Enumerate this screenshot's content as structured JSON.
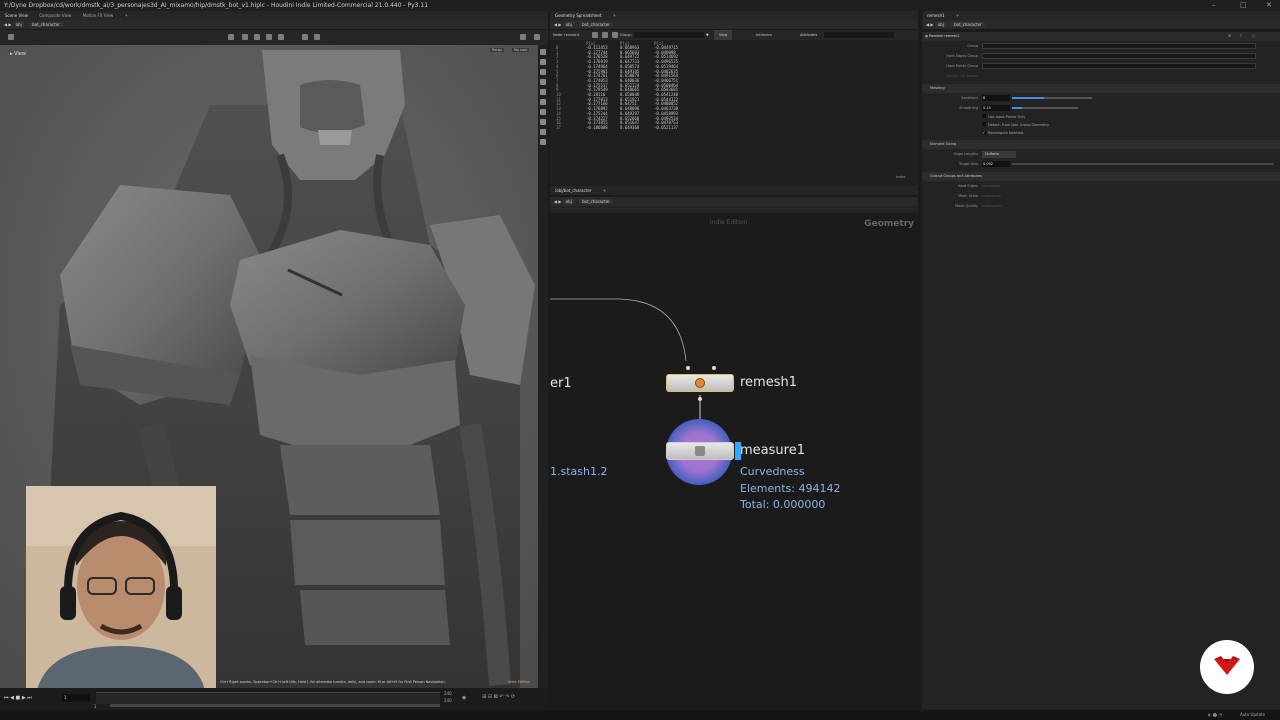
{
  "window": {
    "title": "Y:/Dyne Dropbox/cd/work/dmstk_ai/3_personajes3d_AI_mixamo/hip/dmstk_bot_v1.hiplc - Houdini Indie Limited-Commercial 21.0.440 - Py3.11"
  },
  "viewport": {
    "tabs": [
      "Scene View",
      "Composite View",
      "Motion FX View"
    ],
    "path": [
      "obj",
      "bot_character"
    ],
    "label": "View",
    "corner_buttons": [
      "Persp",
      "No cam"
    ],
    "hint": "Ctrl+Right zooms. Spacebar+Ctrl+Left tilts. Hold L for alternate tumble, dolly, and zoom. M or Alt+M for First Person Navigation.",
    "watermark": "Indie Edition"
  },
  "timeline": {
    "frame": "1",
    "start": "1",
    "end": "240",
    "end2": "240"
  },
  "spreadsheet": {
    "tab": "Geometry Spreadsheet",
    "path": [
      "obj",
      "bot_character"
    ],
    "node_label": "Node: remesh1",
    "group_label": "Group:",
    "view_label": "View",
    "intrinsics_label": "Intrinsics",
    "attributes_label": "Attributes",
    "columns": [
      "",
      "P[x]",
      "P[y]",
      "P[z]"
    ],
    "rows": [
      [
        "0",
        "-0.111453",
        "0.668963",
        "-0.0449715"
      ],
      [
        "1",
        "-0.177744",
        "0.665603",
        "-0.049098"
      ],
      [
        "2",
        "-0.176528",
        "0.649722",
        "-0.0514692"
      ],
      [
        "3",
        "-0.176919",
        "0.647731",
        "-0.0496535"
      ],
      [
        "4",
        "-0.174964",
        "0.650574",
        "-0.0519464"
      ],
      [
        "5",
        "-0.175901",
        "0.649105",
        "-0.0482635"
      ],
      [
        "6",
        "-0.174761",
        "0.658079",
        "-0.0491564"
      ],
      [
        "7",
        "-0.174053",
        "0.640036",
        "-0.0466751"
      ],
      [
        "8",
        "-0.175537",
        "0.652124",
        "-0.0500464"
      ],
      [
        "9",
        "-0.179549",
        "0.648665",
        "-0.0503681"
      ],
      [
        "10",
        "-0.18116",
        "0.650048",
        "-0.0541248"
      ],
      [
        "11",
        "-0.177013",
        "0.651921",
        "-0.0544122"
      ],
      [
        "12",
        "-0.177166",
        "0.64751",
        "-0.0480052"
      ],
      [
        "13",
        "-0.176892",
        "0.648096",
        "-0.0463730"
      ],
      [
        "14",
        "-0.175244",
        "0.649397",
        "-0.0458993"
      ],
      [
        "15",
        "-0.174227",
        "0.652868",
        "-0.0492534"
      ],
      [
        "16",
        "-0.173855",
        "0.651647",
        "-0.0470753"
      ],
      [
        "17",
        "-0.186088",
        "0.649368",
        "-0.0521137"
      ]
    ],
    "footer": "Index"
  },
  "network": {
    "tab": "/obj/bot_character",
    "path": [
      "obj",
      "bot_character"
    ],
    "watermark": "Indie Edition",
    "context_label": "Geometry",
    "left_partial_node": "er1",
    "left_partial_info": "1.stash1.2",
    "remesh": {
      "name": "remesh1"
    },
    "measure": {
      "name": "measure1",
      "info": [
        "Curvedness",
        "Elements: 494142",
        "Total: 0.000000"
      ]
    }
  },
  "params": {
    "tab": "remesh1",
    "path": [
      "obj",
      "bot_character"
    ],
    "header_type": "Remesh",
    "header_name": "remesh1",
    "top_rows": [
      "Group",
      "Hard Edges Group",
      "Hard Points Group",
      "Harden UV Seams"
    ],
    "meshing": {
      "title": "Meshing",
      "iterations_label": "Iterations",
      "iterations_value": "8",
      "smoothing_label": "Smoothing",
      "smoothing_value": "0.15",
      "smoothing_fraction": 0.15,
      "iterations_fraction": 0.4,
      "checks": [
        "Use Input Points Only",
        "Detach From Non-Group Geometry",
        "Recompute Normals"
      ]
    },
    "sizing": {
      "title": "Element Sizing",
      "edge_lengths_label": "Edge Lengths",
      "edge_lengths_value": "Uniform",
      "target_size_label": "Target Size",
      "target_size_value": "0.002"
    },
    "output": {
      "title": "Output Groups and Attributes",
      "rows": [
        [
          "Hard Edges",
          "hardedges"
        ],
        [
          "Mesh Scale",
          "meshscale"
        ],
        [
          "Mesh Quality",
          "meshquality"
        ]
      ]
    }
  },
  "status": {
    "right": "Auto Update"
  }
}
